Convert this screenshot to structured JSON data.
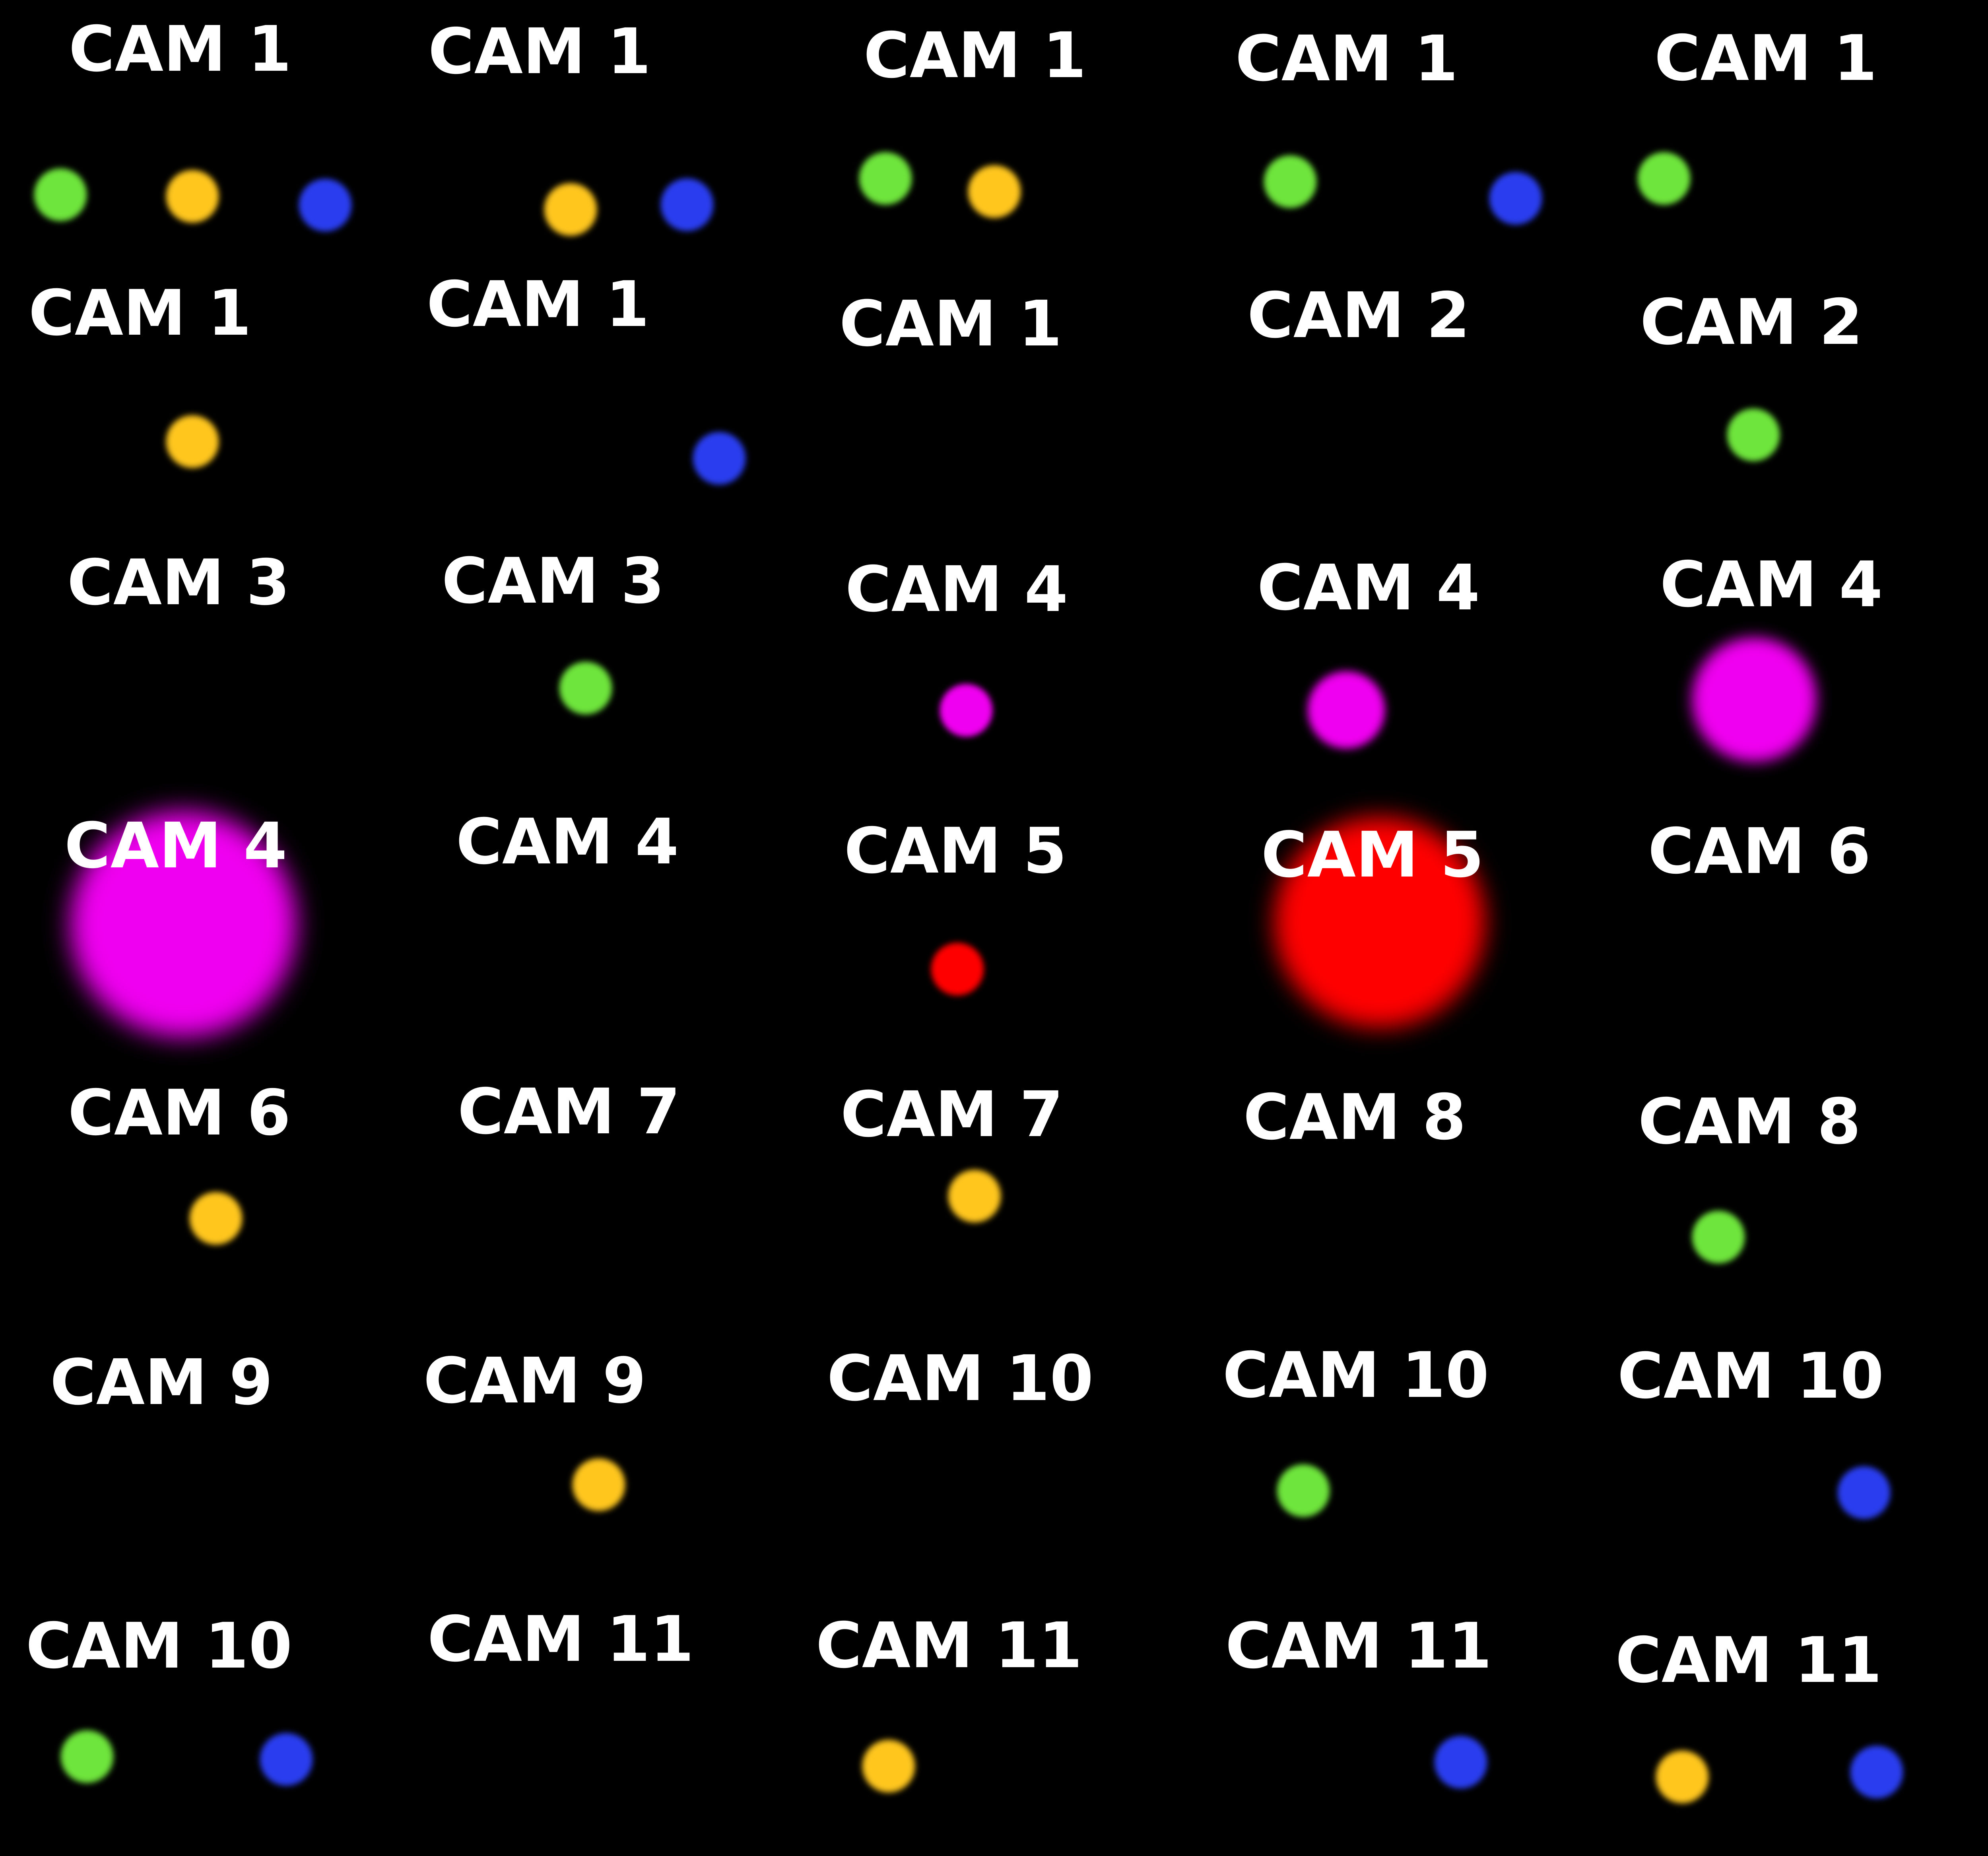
{
  "colors": {
    "background": "#000000",
    "label": "#ffffff",
    "green": "#6ee53c",
    "yellow": "#ffc61e",
    "blue": "#2a3ef0",
    "magenta": "#f000f0",
    "red": "#ff0000"
  },
  "tiles": [
    {
      "label": "CAM 1",
      "dots": [
        {
          "color": "green"
        },
        {
          "color": "yellow"
        },
        {
          "color": "blue"
        }
      ]
    },
    {
      "label": "CAM 1",
      "dots": [
        {
          "color": "yellow"
        },
        {
          "color": "blue"
        }
      ]
    },
    {
      "label": "CAM 1",
      "dots": [
        {
          "color": "green"
        },
        {
          "color": "yellow"
        }
      ]
    },
    {
      "label": "CAM 1",
      "dots": [
        {
          "color": "green"
        },
        {
          "color": "blue"
        }
      ]
    },
    {
      "label": "CAM 1",
      "dots": [
        {
          "color": "green"
        }
      ]
    },
    {
      "label": "CAM 1",
      "dots": [
        {
          "color": "yellow"
        }
      ]
    },
    {
      "label": "CAM 1",
      "dots": [
        {
          "color": "blue"
        }
      ]
    },
    {
      "label": "CAM 1",
      "dots": []
    },
    {
      "label": "CAM 2",
      "dots": []
    },
    {
      "label": "CAM 2",
      "dots": [
        {
          "color": "green"
        }
      ]
    },
    {
      "label": "CAM 3",
      "dots": []
    },
    {
      "label": "CAM 3",
      "dots": [
        {
          "color": "green"
        }
      ]
    },
    {
      "label": "CAM 4",
      "dots": [
        {
          "color": "magenta"
        }
      ]
    },
    {
      "label": "CAM 4",
      "dots": [
        {
          "color": "magenta"
        }
      ]
    },
    {
      "label": "CAM 4",
      "dots": [
        {
          "color": "magenta"
        }
      ]
    },
    {
      "label": "CAM 4",
      "dots": [
        {
          "color": "magenta"
        }
      ]
    },
    {
      "label": "CAM 4",
      "dots": []
    },
    {
      "label": "CAM 5",
      "dots": [
        {
          "color": "red"
        }
      ]
    },
    {
      "label": "CAM 5",
      "dots": [
        {
          "color": "red"
        }
      ]
    },
    {
      "label": "CAM 6",
      "dots": []
    },
    {
      "label": "CAM 6",
      "dots": [
        {
          "color": "yellow"
        }
      ]
    },
    {
      "label": "CAM 7",
      "dots": []
    },
    {
      "label": "CAM 7",
      "dots": [
        {
          "color": "yellow"
        }
      ]
    },
    {
      "label": "CAM 8",
      "dots": []
    },
    {
      "label": "CAM 8",
      "dots": [
        {
          "color": "green"
        }
      ]
    },
    {
      "label": "CAM 9",
      "dots": []
    },
    {
      "label": "CAM 9",
      "dots": [
        {
          "color": "yellow"
        }
      ]
    },
    {
      "label": "CAM 10",
      "dots": []
    },
    {
      "label": "CAM 10",
      "dots": [
        {
          "color": "green"
        }
      ]
    },
    {
      "label": "CAM 10",
      "dots": [
        {
          "color": "blue"
        }
      ]
    },
    {
      "label": "CAM 10",
      "dots": [
        {
          "color": "green"
        },
        {
          "color": "blue"
        }
      ]
    },
    {
      "label": "CAM 11",
      "dots": []
    },
    {
      "label": "CAM 11",
      "dots": [
        {
          "color": "yellow"
        }
      ]
    },
    {
      "label": "CAM 11",
      "dots": [
        {
          "color": "blue"
        }
      ]
    },
    {
      "label": "CAM 11",
      "dots": [
        {
          "color": "yellow"
        },
        {
          "color": "blue"
        }
      ]
    }
  ]
}
